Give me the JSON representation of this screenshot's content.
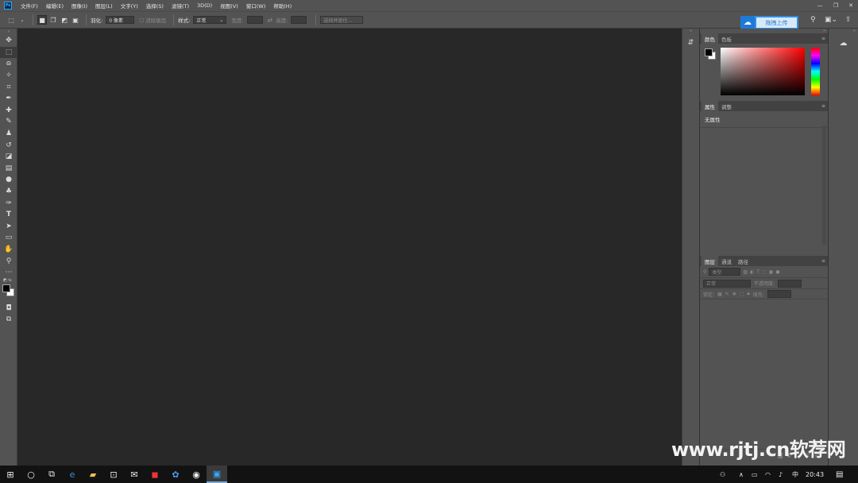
{
  "menubar": {
    "logo": "Ps",
    "items": [
      "文件(F)",
      "编辑(E)",
      "图像(I)",
      "图层(L)",
      "文字(Y)",
      "选择(S)",
      "滤镜(T)",
      "3D(D)",
      "视图(V)",
      "窗口(W)",
      "帮助(H)"
    ],
    "window_controls": [
      "—",
      "❐",
      "✕"
    ]
  },
  "options": {
    "feather_label": "羽化:",
    "feather_value": "0 像素",
    "antialias_label": "消除锯齿",
    "style_label": "样式:",
    "style_value": "正常",
    "width_label": "宽度:",
    "height_label": "高度:",
    "select_mask_label": "选择并遮住..."
  },
  "upload_button": {
    "label": "拖拽上传"
  },
  "panels": {
    "color_tabs": [
      "颜色",
      "色板"
    ],
    "props_tabs": [
      "属性",
      "调整"
    ],
    "props_empty": "无属性",
    "layers_tabs": [
      "图层",
      "通道",
      "路径"
    ],
    "layers_kind": "类型",
    "layers_blend": "正常",
    "layers_opacity_label": "不透明度:",
    "layers_lock_label": "锁定:",
    "layers_fill_label": "填充:"
  },
  "taskbar": {
    "ime": "中",
    "time": "20:43"
  },
  "watermark": "www.rjtj.cn软荐网",
  "colors": {
    "ui_dark": "#535353",
    "canvas_bg": "#282828",
    "accent_blue": "#2f8fe6",
    "taskbar": "#121212"
  }
}
